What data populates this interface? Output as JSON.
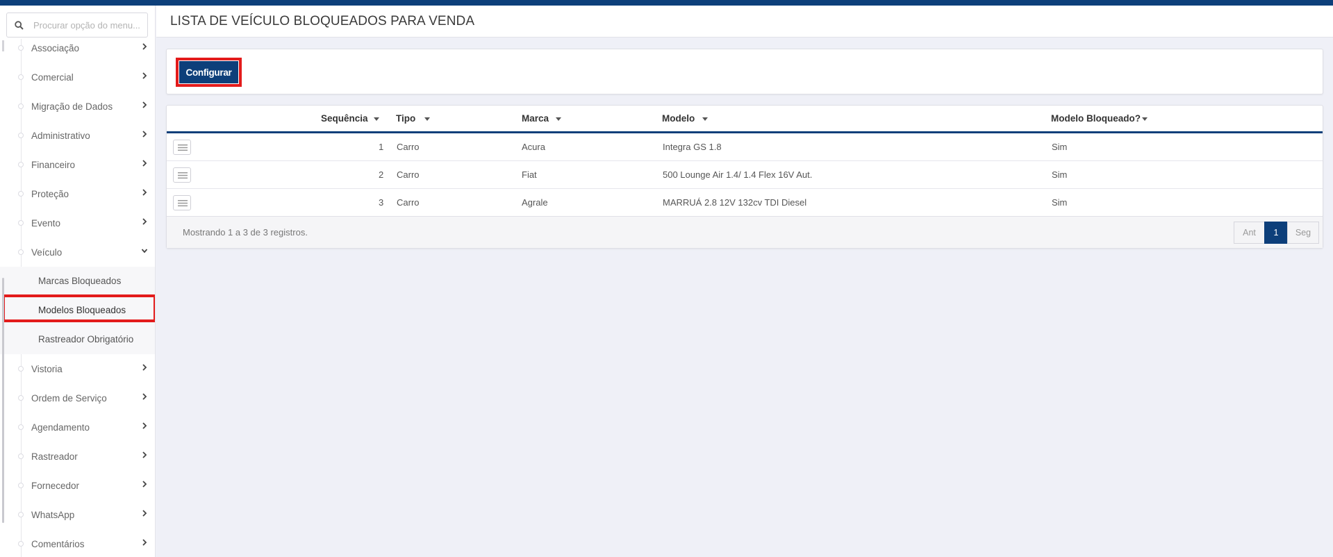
{
  "sidebar": {
    "search_placeholder": "Procurar opção do menu...",
    "items": [
      {
        "label": "Associação"
      },
      {
        "label": "Comercial"
      },
      {
        "label": "Migração de Dados"
      },
      {
        "label": "Administrativo"
      },
      {
        "label": "Financeiro"
      },
      {
        "label": "Proteção"
      },
      {
        "label": "Evento"
      },
      {
        "label": "Veículo"
      },
      {
        "label": "Vistoria"
      },
      {
        "label": "Ordem de Serviço"
      },
      {
        "label": "Agendamento"
      },
      {
        "label": "Rastreador"
      },
      {
        "label": "Fornecedor"
      },
      {
        "label": "WhatsApp"
      },
      {
        "label": "Comentários"
      }
    ],
    "subitems": [
      {
        "label": "Marcas Bloqueados"
      },
      {
        "label": "Modelos Bloqueados"
      },
      {
        "label": "Rastreador Obrigatório"
      }
    ]
  },
  "page": {
    "title": "LISTA DE VEÍCULO BLOQUEADOS PARA VENDA",
    "configure_label": "Configurar"
  },
  "table": {
    "headers": [
      "Sequência",
      "Tipo",
      "Marca",
      "Modelo",
      "Modelo Bloqueado?"
    ],
    "rows": [
      {
        "seq": "1",
        "tipo": "Carro",
        "marca": "Acura",
        "modelo": "Integra GS 1.8",
        "bloqueado": "Sim"
      },
      {
        "seq": "2",
        "tipo": "Carro",
        "marca": "Fiat",
        "modelo": "500 Lounge Air 1.4/ 1.4 Flex 16V Aut.",
        "bloqueado": "Sim"
      },
      {
        "seq": "3",
        "tipo": "Carro",
        "marca": "Agrale",
        "modelo": "MARRUÁ 2.8 12V 132cv TDI Diesel",
        "bloqueado": "Sim"
      }
    ],
    "info": "Mostrando 1 a 3 de 3 registros.",
    "pagination": {
      "prev": "Ant",
      "current": "1",
      "next": "Seg"
    }
  },
  "colors": {
    "primary": "#0d3f7a",
    "highlight": "#e31b1b",
    "background": "#eff0f7"
  }
}
